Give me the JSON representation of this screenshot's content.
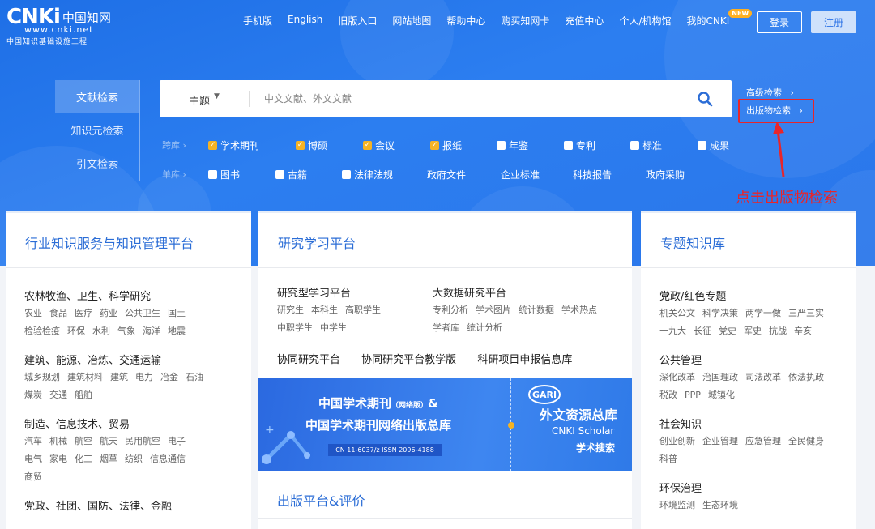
{
  "header": {
    "logo": {
      "brand": "CNKi",
      "brand_cn": "中国知网",
      "url": "www.cnki.net",
      "slogan": "中国知识基础设施工程"
    },
    "nav": [
      "手机版",
      "English",
      "旧版入口",
      "网站地图",
      "帮助中心",
      "购买知网卡",
      "充值中心",
      "个人/机构馆",
      "我的CNKI"
    ],
    "new_badge": "NEW",
    "login": "登录",
    "register": "注册"
  },
  "search": {
    "tabs": [
      "文献检索",
      "知识元检索",
      "引文检索"
    ],
    "field": "主题",
    "placeholder": "中文文献、外文文献",
    "advanced": "高级检索",
    "publication": "出版物检索",
    "row1_label": "跨库",
    "row2_label": "单库",
    "row1": [
      {
        "label": "学术期刊",
        "checked": true
      },
      {
        "label": "博硕",
        "checked": true
      },
      {
        "label": "会议",
        "checked": true
      },
      {
        "label": "报纸",
        "checked": true
      },
      {
        "label": "年鉴",
        "checked": false
      },
      {
        "label": "专利",
        "checked": false
      },
      {
        "label": "标准",
        "checked": false
      },
      {
        "label": "成果",
        "checked": false
      }
    ],
    "row2": [
      {
        "label": "图书",
        "checkbox": true
      },
      {
        "label": "古籍",
        "checkbox": true
      },
      {
        "label": "法律法规",
        "checkbox": true
      },
      {
        "label": "政府文件",
        "checkbox": false
      },
      {
        "label": "企业标准",
        "checkbox": false
      },
      {
        "label": "科技报告",
        "checkbox": false
      },
      {
        "label": "政府采购",
        "checkbox": false
      }
    ]
  },
  "annotation": {
    "text": "点击出版物检索",
    "color": "#e8252a"
  },
  "cards": {
    "industry": {
      "title": "行业知识服务与知识管理平台",
      "groups": [
        {
          "title": "农林牧渔、卫生、科学研究",
          "lines": [
            [
              "农业",
              "食品",
              "医疗",
              "药业",
              "公共卫生",
              "国土"
            ],
            [
              "检验检疫",
              "环保",
              "水利",
              "气象",
              "海洋",
              "地震"
            ]
          ]
        },
        {
          "title": "建筑、能源、冶炼、交通运输",
          "lines": [
            [
              "城乡规划",
              "建筑材料",
              "建筑",
              "电力",
              "冶金",
              "石油"
            ],
            [
              "煤炭",
              "交通",
              "船舶"
            ]
          ]
        },
        {
          "title": "制造、信息技术、贸易",
          "lines": [
            [
              "汽车",
              "机械",
              "航空",
              "航天",
              "民用航空",
              "电子"
            ],
            [
              "电气",
              "家电",
              "化工",
              "烟草",
              "纺织",
              "信息通信"
            ],
            [
              "商贸"
            ]
          ]
        },
        {
          "title": "党政、社团、国防、法律、金融",
          "lines": []
        }
      ]
    },
    "research": {
      "title": "研究学习平台",
      "col1_title": "研究型学习平台",
      "col1_lines": [
        [
          "研究生",
          "本科生",
          "高职学生"
        ],
        [
          "中职学生",
          "中学生"
        ]
      ],
      "col2_title": "大数据研究平台",
      "col2_lines": [
        [
          "专利分析",
          "学术图片",
          "统计数据",
          "学术热点"
        ],
        [
          "学者库",
          "统计分析"
        ]
      ],
      "links": [
        "协同研究平台",
        "协同研究平台教学版",
        "科研项目申报信息库"
      ],
      "banner_left_title1": "中国学术期刊",
      "banner_left_title1_sub": "（网络版）",
      "banner_left_title1_tail": "&",
      "banner_left_title2": "中国学术期刊网络出版总库",
      "banner_left_issn": "CN 11-6037/z  ISSN 2096-4188",
      "banner_right_badge": "GARI",
      "banner_right_title": "外文资源总库",
      "banner_right_scholar": "CNKI Scholar",
      "banner_right_sub": "学术搜索",
      "section2_title": "出版平台&评价"
    },
    "topics": {
      "title": "专题知识库",
      "groups": [
        {
          "title": "党政/红色专题",
          "lines": [
            [
              "机关公文",
              "科学决策",
              "两学一做",
              "三严三实"
            ],
            [
              "十九大",
              "长征",
              "党史",
              "军史",
              "抗战",
              "辛亥"
            ]
          ]
        },
        {
          "title": "公共管理",
          "lines": [
            [
              "深化改革",
              "治国理政",
              "司法改革",
              "依法执政"
            ],
            [
              "税改",
              "PPP",
              "城镇化"
            ]
          ]
        },
        {
          "title": "社会知识",
          "lines": [
            [
              "创业创新",
              "企业管理",
              "应急管理",
              "全民健身"
            ],
            [
              "科普"
            ]
          ]
        },
        {
          "title": "环保治理",
          "lines": [
            [
              "环境监测",
              "生态环境"
            ]
          ]
        }
      ]
    }
  }
}
